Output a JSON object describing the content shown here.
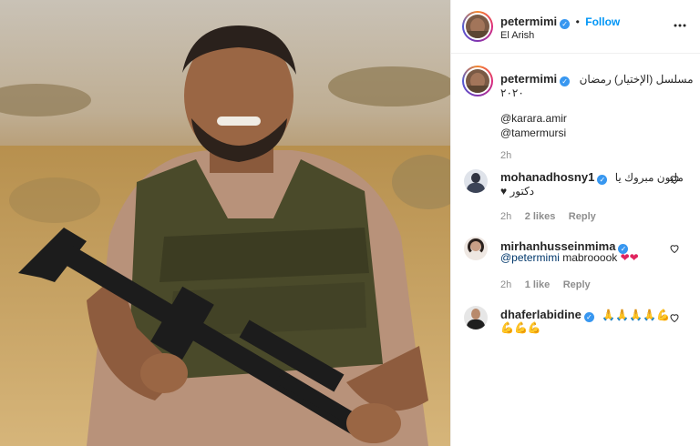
{
  "header": {
    "username": "petermimi",
    "follow_label": "Follow",
    "location": "El Arish",
    "more_icon": "ellipsis-icon"
  },
  "caption": {
    "username": "petermimi",
    "text_line1": "مسلسل (الإختيار) رمضان",
    "text_line2": "٢٠٢٠",
    "mention1": "@karara.amir",
    "mention2": "@tamermursi",
    "time": "2h"
  },
  "comments": [
    {
      "username": "mohanadhosny1",
      "line1": "مليون مبروك يا",
      "line2": "دكتور ♥",
      "time": "2h",
      "likes": "2 likes",
      "reply": "Reply"
    },
    {
      "username": "mirhanhusseinmima",
      "mention": "@petermimi",
      "text": "mabrooook",
      "time": "2h",
      "likes": "1 like",
      "reply": "Reply"
    },
    {
      "username": "dhaferlabidine",
      "line1": "🙏🙏🙏🙏💪",
      "line2": "💪💪💪"
    }
  ],
  "colors": {
    "accent": "#0095f6",
    "verified": "#3897f0"
  }
}
